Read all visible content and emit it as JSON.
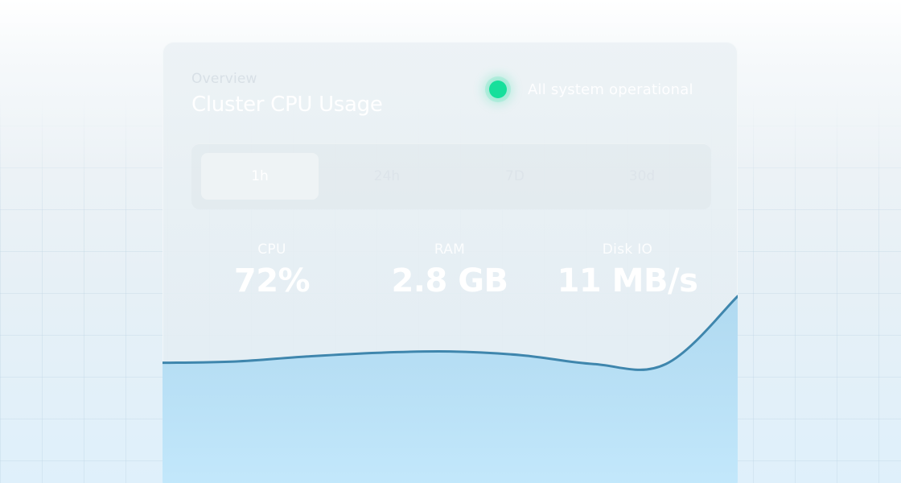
{
  "header": {
    "eyebrow": "Overview",
    "title": "Cluster CPU Usage"
  },
  "status": {
    "text": "All system operational",
    "color": "#17df9b"
  },
  "time_ranges": [
    {
      "label": "1h",
      "active": true
    },
    {
      "label": "24h",
      "active": false
    },
    {
      "label": "7D",
      "active": false
    },
    {
      "label": "30d",
      "active": false
    }
  ],
  "stats": [
    {
      "label": "CPU",
      "value": "72%"
    },
    {
      "label": "RAM",
      "value": "2.8 GB"
    },
    {
      "label": "Disk IO",
      "value": "11 MB/s"
    }
  ],
  "chart_data": {
    "type": "area",
    "x": [
      0,
      1,
      2,
      3,
      4,
      5,
      6,
      7,
      8
    ],
    "y": [
      47,
      48,
      52,
      55,
      56,
      53,
      46,
      46,
      100
    ],
    "colors": {
      "line": "#3f86ad",
      "fill_top": "#a7d6f0",
      "fill_bottom": "#bfe6fb"
    }
  }
}
